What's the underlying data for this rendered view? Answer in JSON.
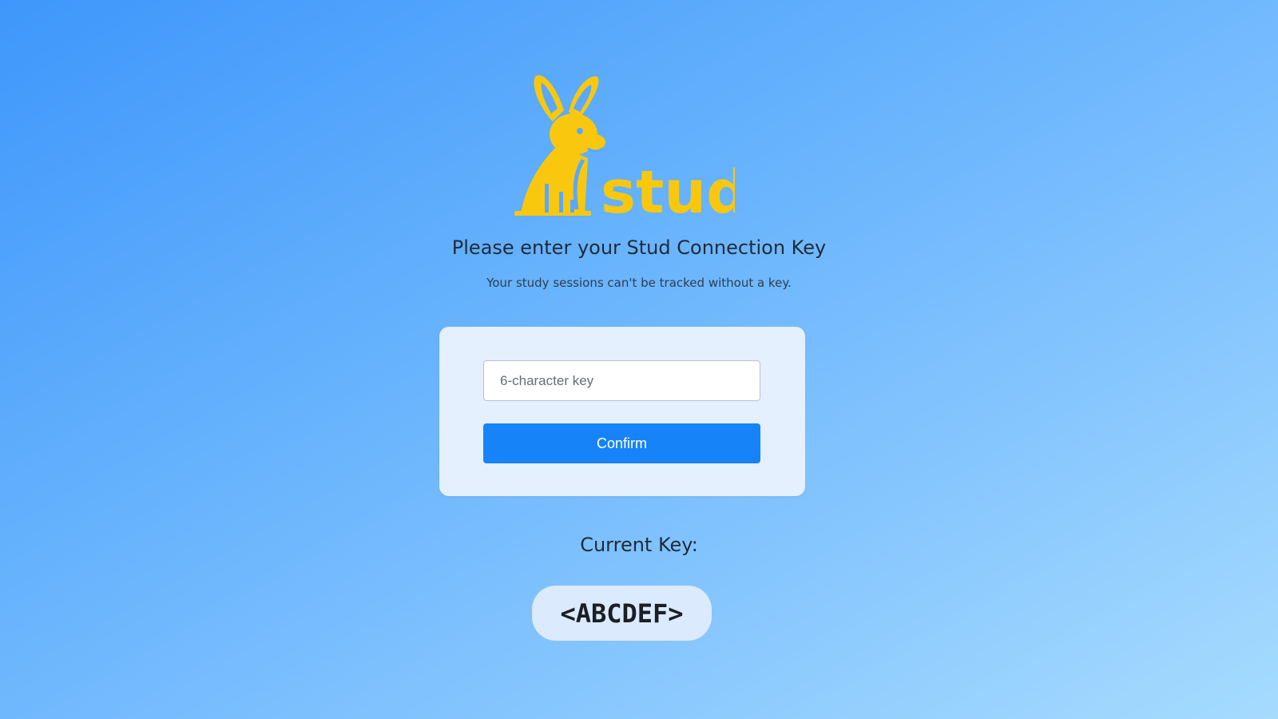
{
  "app": {
    "logo_text": "stud",
    "brand_color": "#f9c80e",
    "logo_icon": "rabbit-icon"
  },
  "prompt": {
    "heading": "Please enter your Stud Connection Key",
    "subheading": "Your study sessions can't be tracked without a key."
  },
  "form": {
    "key_input_value": "",
    "key_input_placeholder": "6-character key",
    "confirm_label": "Confirm",
    "accent_color": "#1783f8"
  },
  "current": {
    "label": "Current Key:",
    "key_value": "<ABCDEF>"
  }
}
